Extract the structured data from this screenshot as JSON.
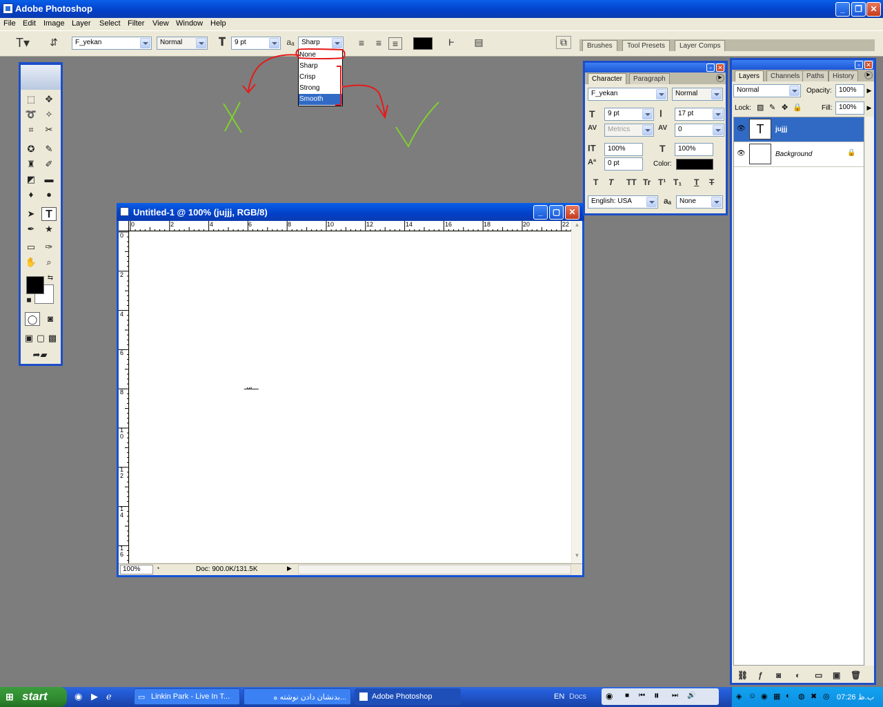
{
  "titlebar": {
    "title": "Adobe Photoshop"
  },
  "menu": [
    "File",
    "Edit",
    "Image",
    "Layer",
    "Select",
    "Filter",
    "View",
    "Window",
    "Help"
  ],
  "options": {
    "font_family": "F_yekan",
    "font_style": "Normal",
    "font_size": "9 pt",
    "antialias": "Sharp",
    "color": "#000000"
  },
  "palette_well": {
    "tabs": [
      "Brushes",
      "Tool Presets",
      "Layer Comps"
    ]
  },
  "antialias_menu": {
    "items": [
      "None",
      "Sharp",
      "Crisp",
      "Strong",
      "Smooth"
    ],
    "highlighted": "Smooth"
  },
  "annotations": {
    "wrong_mark": "X",
    "right_mark": "✓"
  },
  "document": {
    "title": "Untitled-1 @ 100% (jujjj, RGB/8)",
    "ruler_h": [
      "0",
      "2",
      "4",
      "6",
      "8",
      "10",
      "12",
      "14",
      "16",
      "18",
      "20",
      "22"
    ],
    "ruler_v": [
      "0",
      "2",
      "4",
      "6",
      "8",
      "1 0",
      "1 2",
      "1 4",
      "1 6"
    ],
    "canvas_text": "ـــسـ",
    "zoom": "100%",
    "doc_size": "Doc: 900.0K/131.5K"
  },
  "character": {
    "tabs": [
      "Character",
      "Paragraph"
    ],
    "font_family": "F_yekan",
    "font_style": "Normal",
    "size": "9 pt",
    "leading": "17 pt",
    "kerning": "Metrics",
    "tracking": "0",
    "vscale": "100%",
    "hscale": "100%",
    "baseline": "0 pt",
    "color_label": "Color:",
    "color": "#000000",
    "styles": [
      "T",
      "T",
      "TT",
      "Tr",
      "T¹",
      "T₁",
      "T",
      "T"
    ],
    "language": "English: USA",
    "antialias": "None"
  },
  "layers": {
    "tabs": [
      "Layers",
      "Channels",
      "Paths",
      "History"
    ],
    "blend_mode": "Normal",
    "opacity_label": "Opacity:",
    "opacity": "100%",
    "lock_label": "Lock:",
    "fill_label": "Fill:",
    "fill": "100%",
    "items": [
      {
        "name": "jujjj",
        "selected": true
      },
      {
        "name": "Background",
        "selected": false
      }
    ]
  },
  "taskbar": {
    "start": "start",
    "tasks": [
      "Linkin Park - Live In T...",
      "...بدنشان دادن نوشته ه",
      "Adobe Photoshop"
    ],
    "lang": "EN",
    "docs": "Docs",
    "time": "07:26 ب.ظ"
  }
}
